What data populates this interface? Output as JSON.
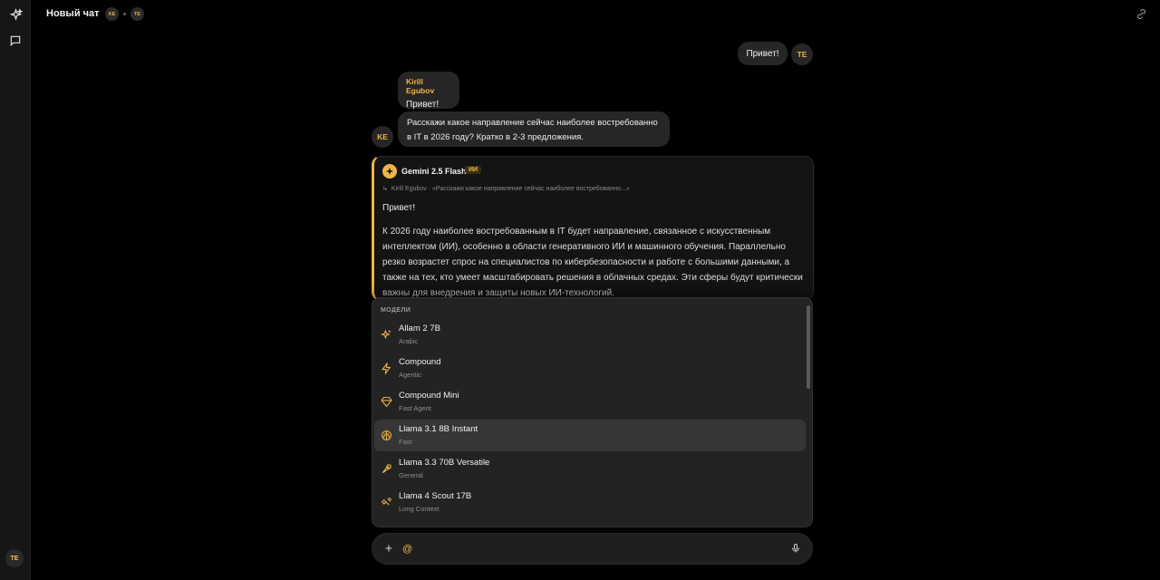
{
  "header": {
    "title": "Новый чат",
    "participants": [
      "KE",
      "TE"
    ]
  },
  "sidebar": {
    "user_initials": "TE"
  },
  "messages": {
    "my_message": {
      "text": "Привет!",
      "avatar": "TE"
    },
    "ke_group": {
      "name": "Kirill Egubov",
      "avatar": "KE",
      "msg1": "Привет!",
      "msg2": "Расскажи какое направление сейчас наиболее востребованно в IT в 2026 году? Кратко в 2-3 предложения."
    },
    "ai_message": {
      "model": "Gemini 2.5 Flash",
      "badge": "ИИ",
      "reply_to": "Kirill Egubov · «Расскажи какое направление сейчас наиболее востребованно...»",
      "greeting": "Привет!",
      "body": "К 2026 году наиболее востребованным в IT будет направление, связанное с искусственным интеллектом (ИИ), особенно в области генеративного ИИ и машинного обучения. Параллельно резко возрастет спрос на специалистов по кибербезопасности и работе с большими данными, а также на тех, кто умеет масштабировать решения в облачных средах. Эти сферы будут критически важны для внедрения и защиты новых ИИ-технологий."
    }
  },
  "models_dropdown": {
    "heading": "МОДЕЛИ",
    "items": [
      {
        "name": "Allam 2 7B",
        "sub": "Arabic",
        "icon": "sparkles-icon"
      },
      {
        "name": "Compound",
        "sub": "Agentic",
        "icon": "lightning-icon"
      },
      {
        "name": "Compound Mini",
        "sub": "Fast Agent",
        "icon": "diamond-icon"
      },
      {
        "name": "Llama 3.1 8B Instant",
        "sub": "Fast",
        "icon": "brain-icon",
        "active": true
      },
      {
        "name": "Llama 3.3 70B Versatile",
        "sub": "General",
        "icon": "rocket-icon"
      },
      {
        "name": "Llama 4 Scout 17B",
        "sub": "Long Context",
        "icon": "satellite-icon"
      }
    ]
  },
  "composer": {
    "value": "@"
  },
  "colors": {
    "accent": "#f0b447",
    "background": "#000000",
    "bubble": "#262626"
  }
}
